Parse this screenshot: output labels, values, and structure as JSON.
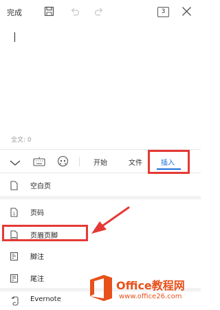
{
  "header": {
    "done_label": "完成",
    "page_indicator": "3"
  },
  "editor": {
    "word_count": "全文: 0"
  },
  "toolbar": {
    "tabs": [
      {
        "label": "开始"
      },
      {
        "label": "文件"
      },
      {
        "label": "插入"
      }
    ],
    "active_tab": "插入"
  },
  "insert_menu": {
    "items": [
      {
        "label": "空白页",
        "icon": "blank-page-icon"
      },
      {
        "label": "页码",
        "icon": "page-number-icon"
      },
      {
        "label": "页眉页脚",
        "icon": "header-footer-icon"
      },
      {
        "label": "脚注",
        "icon": "footnote-icon"
      },
      {
        "label": "尾注",
        "icon": "endnote-icon"
      },
      {
        "label": "Evernote",
        "icon": "evernote-icon"
      }
    ]
  },
  "watermark": {
    "brand": "Office教程网",
    "url": "www.office26.com"
  },
  "colors": {
    "accent": "#1e6fd9",
    "highlight": "#e53935",
    "watermark_orange": "#e8501a"
  }
}
